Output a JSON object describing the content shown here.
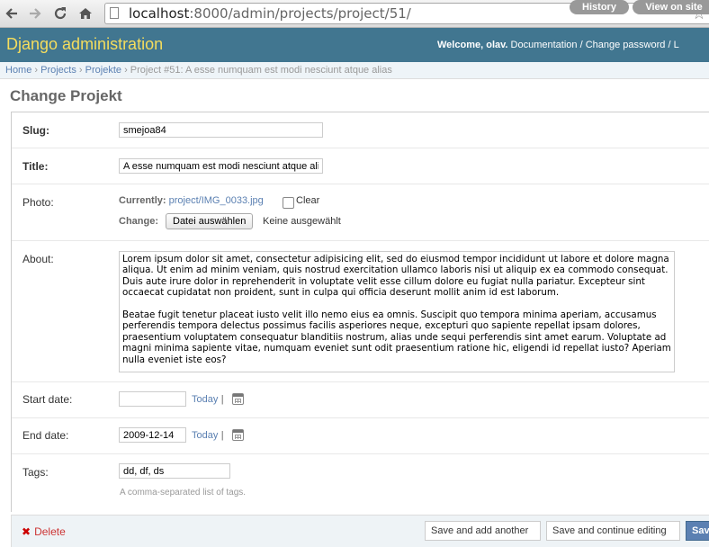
{
  "browser": {
    "url_host": "localhost",
    "url_rest": ":8000/admin/projects/project/51/"
  },
  "header": {
    "branding": "Django administration",
    "welcome": "Welcome, ",
    "username": "olav.",
    "documentation": "Documentation",
    "change_password": "Change password",
    "sep": " / ",
    "log_out": "L"
  },
  "breadcrumbs": {
    "home": "Home",
    "projects": "Projects",
    "projekte": "Projekte",
    "sep": " › ",
    "current": "Project #51: A esse numquam est modi nesciunt atque alias"
  },
  "page_title": "Change Projekt",
  "object_tools": {
    "history": "History",
    "view_on_site": "View on site"
  },
  "form": {
    "slug": {
      "label": "Slug:",
      "value": "smejoa84"
    },
    "title": {
      "label": "Title:",
      "value": "A esse numquam est modi nesciunt atque alias"
    },
    "photo": {
      "label": "Photo:",
      "currently_label": "Currently:",
      "currently_value": "project/IMG_0033.jpg",
      "clear_label": "Clear",
      "change_label": "Change:",
      "choose_button": "Datei auswählen",
      "no_file": "Keine ausgewählt"
    },
    "about": {
      "label": "About:",
      "value": "Lorem ipsum dolor sit amet, consectetur adipisicing elit, sed do eiusmod tempor incididunt ut labore et dolore magna aliqua. Ut enim ad minim veniam, quis nostrud exercitation ullamco laboris nisi ut aliquip ex ea commodo consequat. Duis aute irure dolor in reprehenderit in voluptate velit esse cillum dolore eu fugiat nulla pariatur. Excepteur sint occaecat cupidatat non proident, sunt in culpa qui officia deserunt mollit anim id est laborum.\n\nBeatae fugit tenetur placeat iusto velit illo nemo eius ea omnis. Suscipit quo tempora minima aperiam, accusamus perferendis tempora delectus possimus facilis asperiores neque, excepturi quo sapiente repellat ipsam dolores, praesentium voluptatem consequatur blanditiis nostrum, alias unde sequi perferendis sint amet earum. Voluptate ad magni minima sapiente vitae, numquam eveniet sunt odit praesentium ratione hic, eligendi id repellat iusto? Aperiam nulla eveniet iste eos?"
    },
    "start_date": {
      "label": "Start date:",
      "value": "",
      "today": "Today",
      "pipe": "|"
    },
    "end_date": {
      "label": "End date:",
      "value": "2009-12-14",
      "today": "Today",
      "pipe": "|"
    },
    "tags": {
      "label": "Tags:",
      "value": "dd, df, ds",
      "help": "A comma-separated list of tags."
    }
  },
  "submit": {
    "delete": "Delete",
    "save_add_another": "Save and add another",
    "save_continue": "Save and continue editing",
    "save": "Save"
  }
}
